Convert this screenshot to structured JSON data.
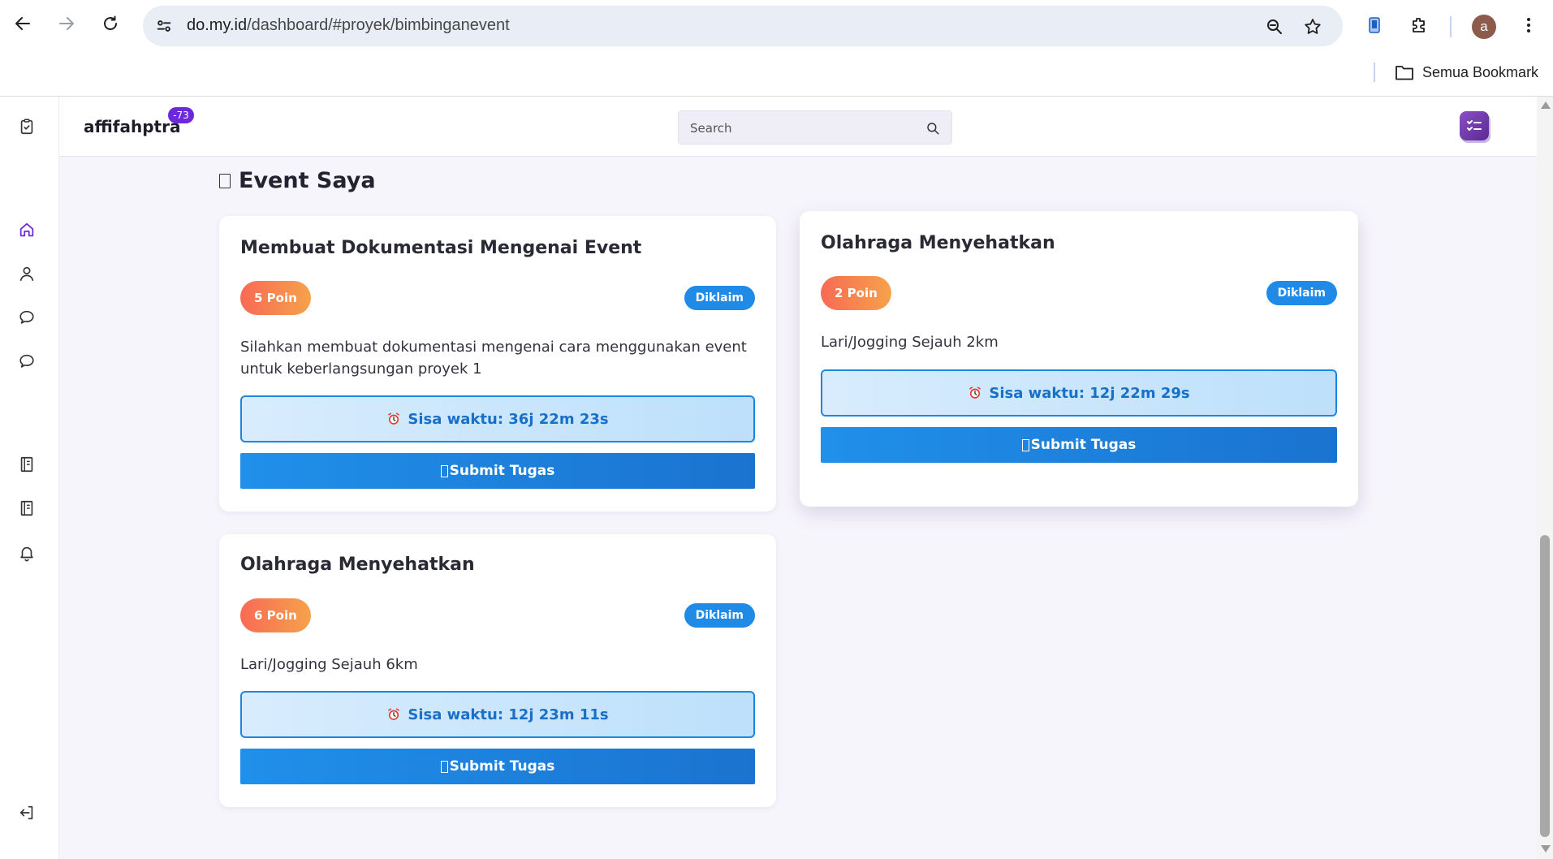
{
  "browser": {
    "url_host": "do.my.id",
    "url_path": "/dashboard/#proyek/bimbinganevent",
    "profile_initial": "a",
    "bookmarks_all_label": "Semua Bookmark"
  },
  "header": {
    "username": "affifahptra",
    "badge_count": "-73",
    "search_placeholder": "Search"
  },
  "main": {
    "section_title": "Event Saya",
    "cards": [
      {
        "title": "Membuat Dokumentasi Mengenai Event",
        "points": "5 Poin",
        "status": "Diklaim",
        "description": "Silahkan membuat dokumentasi mengenai cara menggunakan event untuk keberlangsungan proyek 1",
        "timer": "Sisa waktu: 36j 22m 23s",
        "submit_label": "Submit Tugas"
      },
      {
        "title": "Olahraga Menyehatkan",
        "points": "2 Poin",
        "status": "Diklaim",
        "description": "Lari/Jogging Sejauh 2km",
        "timer": "Sisa waktu: 12j 22m 29s",
        "submit_label": "Submit Tugas"
      },
      {
        "title": "Olahraga Menyehatkan",
        "points": "6 Poin",
        "status": "Diklaim",
        "description": "Lari/Jogging Sejauh 6km",
        "timer": "Sisa waktu: 12j 23m 11s",
        "submit_label": "Submit Tugas"
      }
    ]
  },
  "sidebar": {
    "icons": [
      "clipboard-check-icon",
      "home-icon",
      "user-icon",
      "chat-icon",
      "chat-icon",
      "notebook-icon",
      "notebook-icon",
      "bell-icon",
      "logout-icon"
    ]
  },
  "colors": {
    "accent_purple": "#6d28d9",
    "claim_blue": "#1f8be6",
    "points_gradient_start": "#f86a55",
    "points_gradient_end": "#f6a24b",
    "timer_text": "#1a6fc6"
  }
}
